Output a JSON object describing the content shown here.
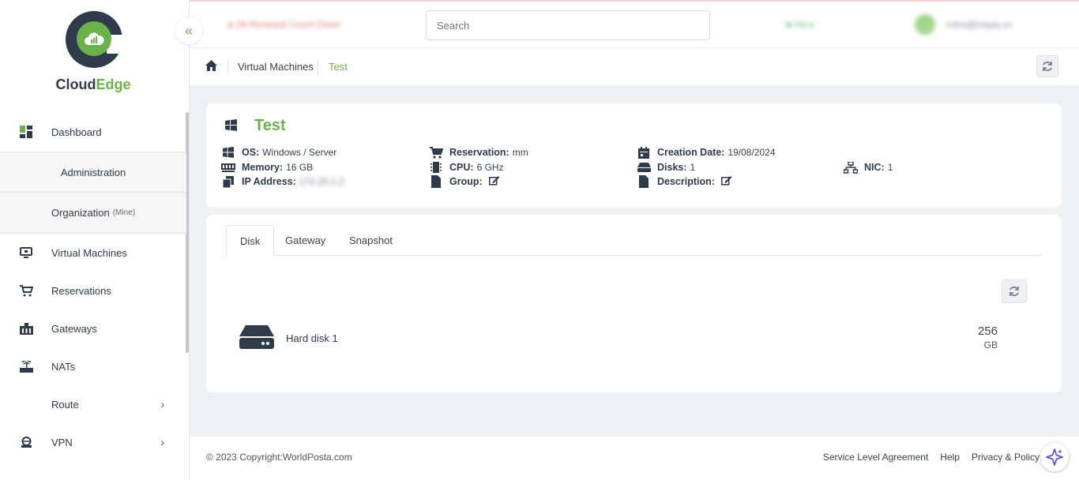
{
  "brand": {
    "name_part1": "Cloud",
    "name_part2": "Edge",
    "accent": "#6cb24a",
    "dark": "#2f3a4a"
  },
  "topbar": {
    "countdown": "28 Renewal Count Down",
    "search_placeholder": "Search",
    "org_label": "Mine",
    "user_email": "mine@maya.co"
  },
  "sidebar": {
    "dashboard": "Dashboard",
    "administration": "Administration",
    "organization": "Organization",
    "organization_tag": "(Mine)",
    "items": {
      "virtual_machines": "Virtual Machines",
      "reservations": "Reservations",
      "gateways": "Gateways",
      "nats": "NATs",
      "route": "Route",
      "vpn": "VPN"
    }
  },
  "breadcrumb": {
    "section": "Virtual Machines",
    "current": "Test"
  },
  "vm": {
    "name": "Test",
    "os_label": "OS:",
    "os": "Windows / Server",
    "memory_label": "Memory:",
    "memory": "16 GB",
    "ip_label": "IP Address:",
    "ip": "172.20.1.2",
    "reservation_label": "Reservation:",
    "reservation": "mm",
    "cpu_label": "CPU:",
    "cpu": "6 GHz",
    "group_label": "Group:",
    "creation_label": "Creation Date:",
    "creation": "19/08/2024",
    "disks_label": "Disks:",
    "disks": "1",
    "description_label": "Description:",
    "nic_label": "NIC:",
    "nic": "1"
  },
  "tabs": {
    "disk": "Disk",
    "gateway": "Gateway",
    "snapshot": "Snapshot",
    "active": "Disk"
  },
  "disk_list": [
    {
      "name": "Hard disk 1",
      "size": "256",
      "unit": "GB"
    }
  ],
  "footer": {
    "copyright": "© 2023 Copyright:WorldPosta.com",
    "sla": "Service Level Agreement",
    "help": "Help",
    "privacy": "Privacy & Policy"
  }
}
